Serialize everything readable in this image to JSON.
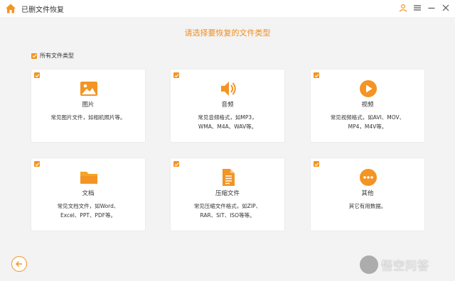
{
  "window": {
    "title": "已删文件恢复"
  },
  "heading": "请选择要恢复的文件类型",
  "all_types": {
    "label": "所有文件类型",
    "checked": true
  },
  "cards": [
    {
      "name": "图片",
      "icon": "image-icon",
      "desc1": "常见图片文件，如相机照片等。",
      "desc2": "",
      "checked": true
    },
    {
      "name": "音频",
      "icon": "speaker-icon",
      "desc1": "常见音频格式，如MP3，",
      "desc2": "WMA、M4A、WAV等。",
      "checked": true
    },
    {
      "name": "视频",
      "icon": "play-icon",
      "desc1": "常见视频格式，如AVI、MOV、",
      "desc2": "MP4，M4V等。",
      "checked": true
    },
    {
      "name": "文档",
      "icon": "folder-icon",
      "desc1": "常见文档文件，如Word、",
      "desc2": "Excel、PPT、PDF等。",
      "checked": true
    },
    {
      "name": "压缩文件",
      "icon": "archive-file-icon",
      "desc1": "常见压缩文件格式，如ZIP、",
      "desc2": "RAR、SIT、ISO等等。",
      "checked": true
    },
    {
      "name": "其他",
      "icon": "more-icon",
      "desc1": "其它有用数据。",
      "desc2": "",
      "checked": true
    }
  ],
  "watermark": {
    "text": "悟空问答"
  },
  "colors": {
    "accent": "#f39423",
    "heading": "#f08c1e",
    "background": "#f3f3f3"
  }
}
